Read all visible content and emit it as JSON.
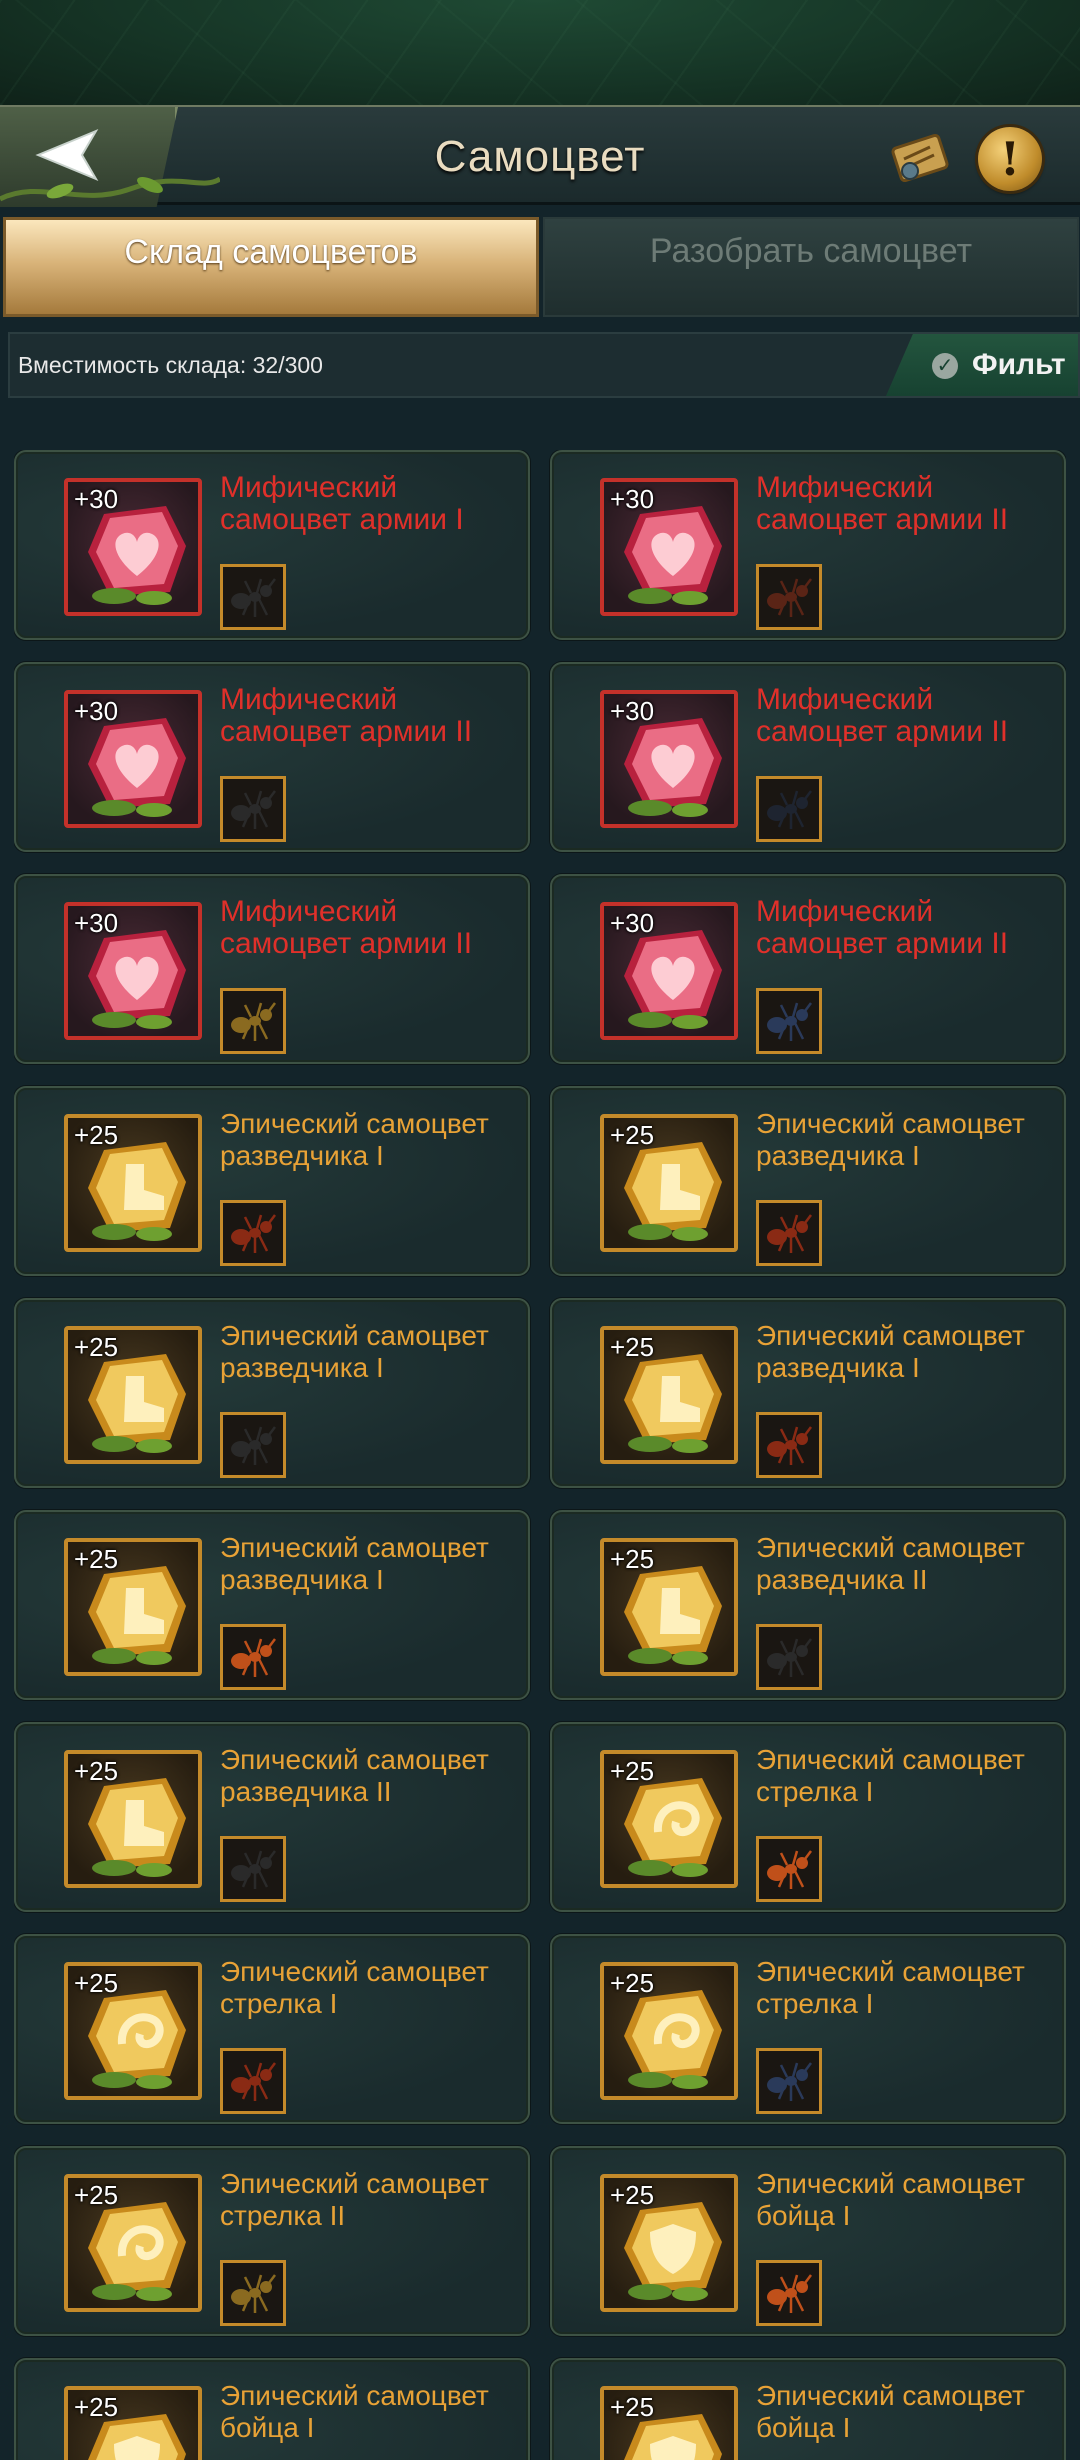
{
  "header": {
    "title": "Самоцвет"
  },
  "tabs": [
    {
      "label": "Склад самоцветов",
      "active": true
    },
    {
      "label": "Разобрать самоцвет",
      "active": false
    }
  ],
  "capacity": {
    "text": "Вместимость склада: 32/300"
  },
  "filter": {
    "label": "Фильт"
  },
  "colors": {
    "mythic": "#e0302a",
    "epic": "#e8a236",
    "accent": "#d9b47a"
  },
  "gems": [
    {
      "plus": "+30",
      "name": "Мифический самоцвет армии I",
      "rarity": "mythic",
      "icon": "heart-rune-icon",
      "ant": "black-ant-icon"
    },
    {
      "plus": "+30",
      "name": "Мифический самоцвет армии II",
      "rarity": "mythic",
      "icon": "heart-rune-icon",
      "ant": "red-brown-ant-icon"
    },
    {
      "plus": "+30",
      "name": "Мифический самоцвет армии II",
      "rarity": "mythic",
      "icon": "heart-rune-icon",
      "ant": "black-ant-icon"
    },
    {
      "plus": "+30",
      "name": "Мифический самоцвет армии II",
      "rarity": "mythic",
      "icon": "heart-rune-icon",
      "ant": "mandible-ant-icon"
    },
    {
      "plus": "+30",
      "name": "Мифический самоцвет армии II",
      "rarity": "mythic",
      "icon": "heart-rune-icon",
      "ant": "golden-ant-icon"
    },
    {
      "plus": "+30",
      "name": "Мифический самоцвет армии II",
      "rarity": "mythic",
      "icon": "heart-rune-icon",
      "ant": "blue-ant-icon"
    },
    {
      "plus": "+25",
      "name": "Эпический самоцвет разведчика I",
      "rarity": "epic",
      "icon": "boot-rune-icon",
      "ant": "red-ant-icon"
    },
    {
      "plus": "+25",
      "name": "Эпический самоцвет разведчика I",
      "rarity": "epic",
      "icon": "boot-rune-icon",
      "ant": "red-ant-icon"
    },
    {
      "plus": "+25",
      "name": "Эпический самоцвет разведчика I",
      "rarity": "epic",
      "icon": "boot-rune-icon",
      "ant": "black-ant-icon"
    },
    {
      "plus": "+25",
      "name": "Эпический самоцвет разведчика I",
      "rarity": "epic",
      "icon": "boot-rune-icon",
      "ant": "red-ant-icon"
    },
    {
      "plus": "+25",
      "name": "Эпический самоцвет разведчика I",
      "rarity": "epic",
      "icon": "boot-rune-icon",
      "ant": "orange-ant-icon"
    },
    {
      "plus": "+25",
      "name": "Эпический самоцвет разведчика II",
      "rarity": "epic",
      "icon": "boot-rune-icon",
      "ant": "black-ant-icon"
    },
    {
      "plus": "+25",
      "name": "Эпический самоцвет разведчика II",
      "rarity": "epic",
      "icon": "boot-rune-icon",
      "ant": "black-ant-icon"
    },
    {
      "plus": "+25",
      "name": "Эпический самоцвет стрелка I",
      "rarity": "epic",
      "icon": "hook-rune-icon",
      "ant": "orange-ant-icon"
    },
    {
      "plus": "+25",
      "name": "Эпический самоцвет стрелка I",
      "rarity": "epic",
      "icon": "hook-rune-icon",
      "ant": "red-ant-icon"
    },
    {
      "plus": "+25",
      "name": "Эпический самоцвет стрелка I",
      "rarity": "epic",
      "icon": "hook-rune-icon",
      "ant": "blue-ant-icon"
    },
    {
      "plus": "+25",
      "name": "Эпический самоцвет стрелка II",
      "rarity": "epic",
      "icon": "hook-rune-icon",
      "ant": "golden-ant-icon"
    },
    {
      "plus": "+25",
      "name": "Эпический самоцвет бойца I",
      "rarity": "epic",
      "icon": "shield-rune-icon",
      "ant": "orange-ant-icon"
    },
    {
      "plus": "+25",
      "name": "Эпический самоцвет бойца I",
      "rarity": "epic",
      "icon": "shield-rune-icon",
      "ant": "black-ant-icon"
    },
    {
      "plus": "+25",
      "name": "Эпический самоцвет бойца I",
      "rarity": "epic",
      "icon": "shield-rune-icon",
      "ant": "orange-ant-icon"
    }
  ]
}
